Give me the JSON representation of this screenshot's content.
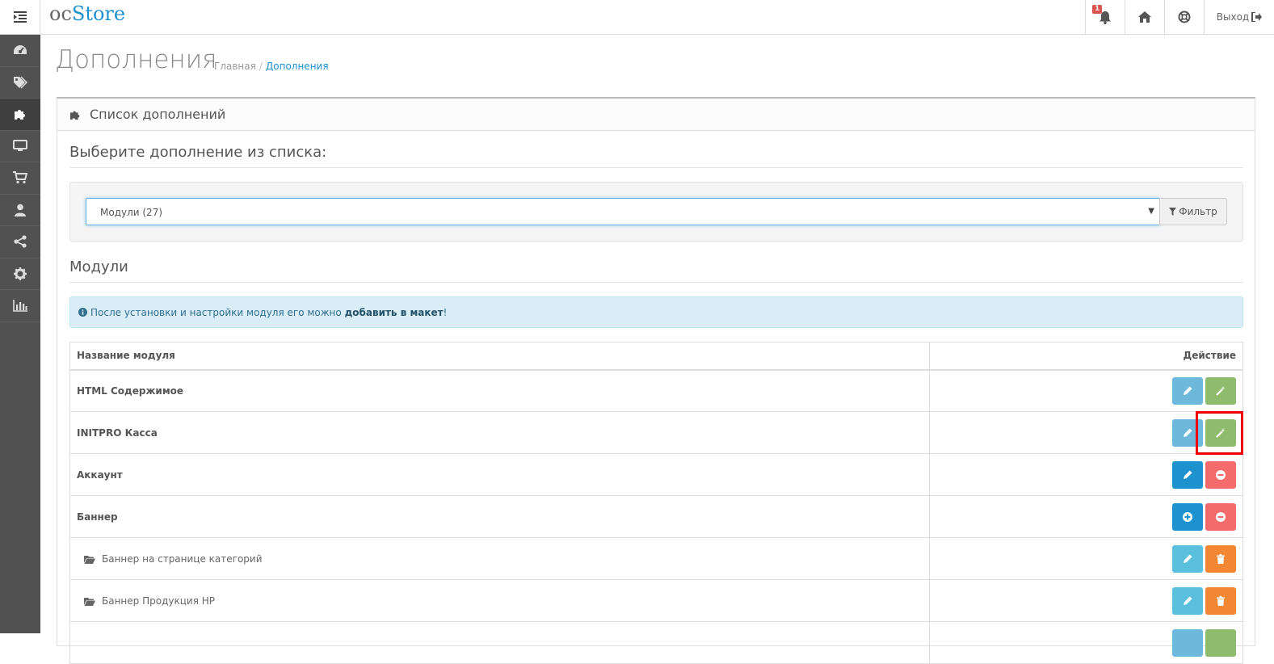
{
  "header": {
    "logo_oc": "oc",
    "logo_store": "Store",
    "notification_count": "1",
    "logout_label": "Выход"
  },
  "sidebar": {
    "items": [
      "dashboard-icon",
      "tags-icon",
      "puzzle-icon",
      "desktop-icon",
      "cart-icon",
      "user-icon",
      "share-icon",
      "cog-icon",
      "bar-chart-icon"
    ],
    "active": "puzzle-icon"
  },
  "page": {
    "title": "Дополнения",
    "breadcrumb": [
      {
        "label": "Главная"
      },
      {
        "label": "Дополнения"
      }
    ]
  },
  "panel": {
    "heading": "Список дополнений",
    "choose_label": "Выберите дополнение из списка:",
    "select_value": "Модули (27)",
    "filter_label": "Фильтр",
    "modules_title": "Модули",
    "alert_prefix": "После установки и настройки модуля его можно ",
    "alert_bold": "добавить в макет",
    "alert_suffix": "!"
  },
  "table": {
    "headers": {
      "name": "Название модуля",
      "action": "Действие"
    },
    "rows": [
      {
        "name": "HTML Содержимое"
      },
      {
        "name": "INITPRO Касса"
      },
      {
        "name": "Аккаунт"
      },
      {
        "name": "Баннер"
      },
      {
        "name": "Баннер на странице категорий"
      },
      {
        "name": "Баннер Продукция HP"
      }
    ]
  },
  "colors": {
    "accent": "#1e91cf",
    "success": "#8fbb6c",
    "danger": "#f56b6b",
    "warning": "#f38733",
    "info": "#5bc0de",
    "sidebar": "#515151",
    "highlight": "#ee0000"
  }
}
